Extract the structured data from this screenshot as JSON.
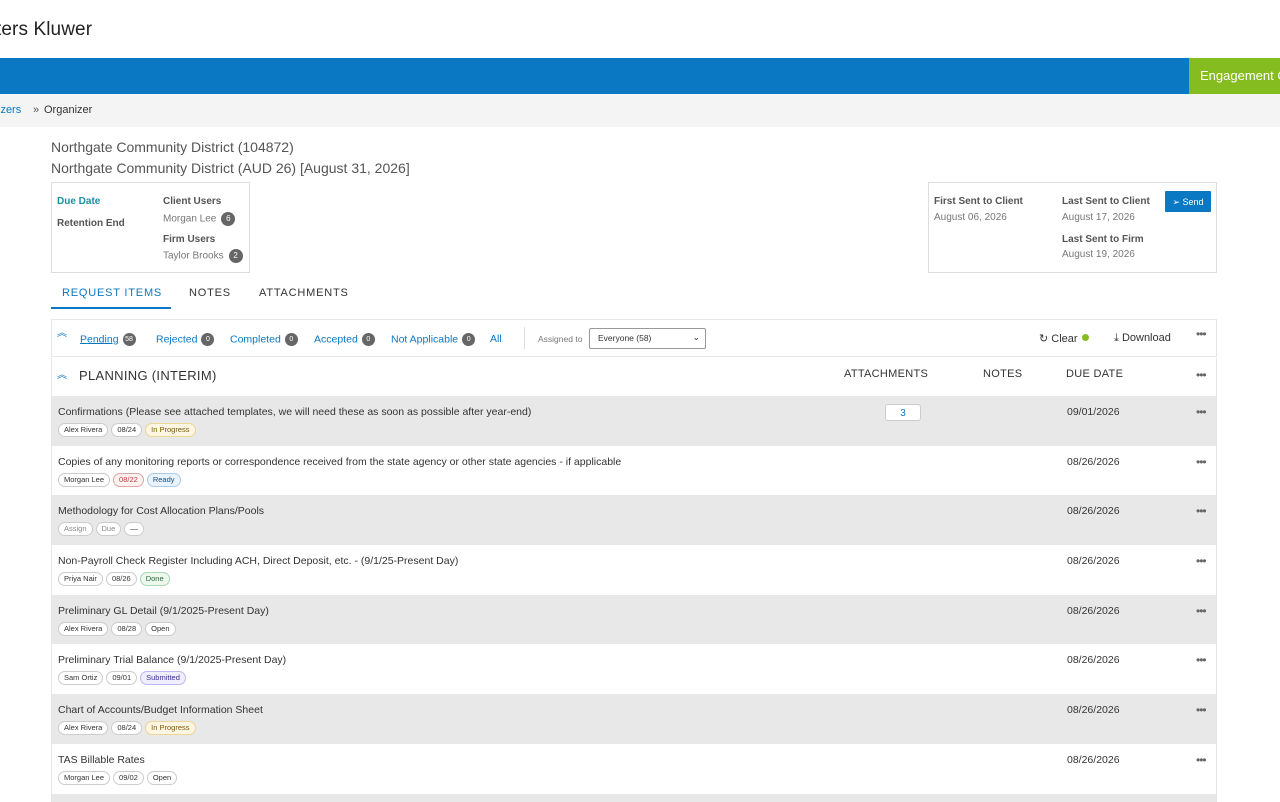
{
  "header": {
    "brand": "ters Kluwer",
    "engagement_label": "Engagement C"
  },
  "breadcrumb": {
    "link": "izers",
    "separator": "»",
    "current": "Organizer"
  },
  "page": {
    "title1": "Northgate Community District (104872)",
    "title2": "Northgate Community District (AUD 26) [August 31, 2026]"
  },
  "info": {
    "due_date_label": "Due Date",
    "retention_end_label": "Retention End",
    "client_users_label": "Client Users",
    "client_user_name": "Morgan Lee",
    "client_user_count": "6",
    "firm_users_label": "Firm Users",
    "firm_user_name": "Taylor Brooks",
    "firm_user_count": "2"
  },
  "sent": {
    "first_sent_label": "First Sent to Client",
    "first_sent_date": "August 06, 2026",
    "last_sent_client_label": "Last Sent to Client",
    "last_sent_client_date": "August 17, 2026",
    "last_sent_firm_label": "Last Sent to Firm",
    "last_sent_firm_date": "August 19, 2026",
    "send_label": "Send"
  },
  "tabs": [
    {
      "label": "REQUEST ITEMS"
    },
    {
      "label": "NOTES"
    },
    {
      "label": "ATTACHMENTS"
    }
  ],
  "filters": [
    {
      "label": "Pending",
      "count": "58"
    },
    {
      "label": "Rejected",
      "count": "0"
    },
    {
      "label": "Completed",
      "count": "0"
    },
    {
      "label": "Accepted",
      "count": "0"
    },
    {
      "label": "Not Applicable",
      "count": "0"
    },
    {
      "label": "All"
    }
  ],
  "assigned": {
    "label": "Assigned to",
    "value": "Everyone (58)"
  },
  "actions": {
    "clear": "Clear",
    "download": "Download"
  },
  "section": {
    "title": "PLANNING (INTERIM)",
    "col_attachments": "ATTACHMENTS",
    "col_notes": "NOTES",
    "col_due_date": "DUE DATE"
  },
  "rows": [
    {
      "title": "Confirmations (Please see attached templates, we will need these as soon as possible after year-end)",
      "assignee": "Alex Rivera",
      "date": "08/24",
      "status": "In Progress",
      "attachments": "3",
      "due": "09/01/2026"
    },
    {
      "title": "Copies of any monitoring reports or correspondence received from the state agency or other state agencies - if applicable",
      "assignee": "Morgan Lee",
      "date": "08/22",
      "status": "Ready",
      "due": "08/26/2026"
    },
    {
      "title": "Methodology for Cost Allocation Plans/Pools",
      "assignee": "Assign",
      "date": "Due",
      "status": "—",
      "due": "08/26/2026"
    },
    {
      "title": "Non-Payroll Check Register Including ACH, Direct Deposit, etc. - (9/1/25-Present Day)",
      "assignee": "Priya Nair",
      "date": "08/26",
      "status": "Done",
      "due": "08/26/2026"
    },
    {
      "title": "Preliminary GL Detail (9/1/2025-Present Day)",
      "assignee": "Alex Rivera",
      "date": "08/28",
      "status": "Open",
      "due": "08/26/2026"
    },
    {
      "title": "Preliminary Trial Balance (9/1/2025-Present Day)",
      "assignee": "Sam Ortiz",
      "date": "09/01",
      "status": "Submitted",
      "due": "08/26/2026"
    },
    {
      "title": "Chart of Accounts/Budget Information Sheet",
      "assignee": "Alex Rivera",
      "date": "08/24",
      "status": "In Progress",
      "due": "08/26/2026"
    },
    {
      "title": "TAS Billable Rates",
      "assignee": "Morgan Lee",
      "date": "09/02",
      "status": "Open",
      "due": "08/26/2026"
    }
  ]
}
